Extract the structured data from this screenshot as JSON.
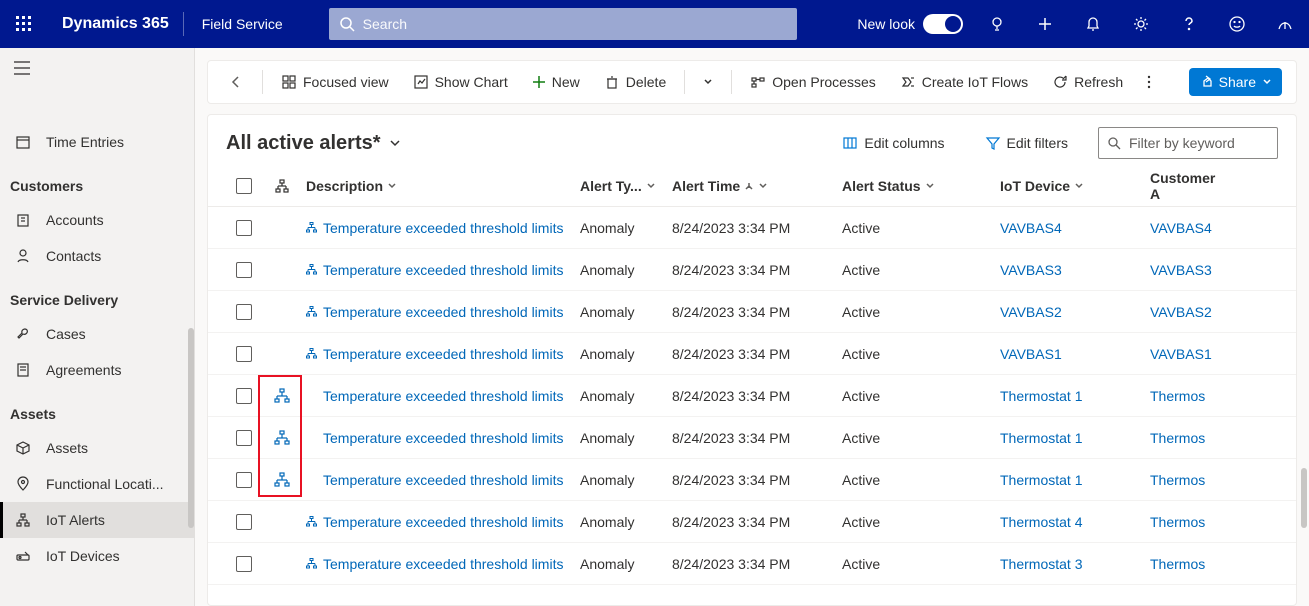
{
  "header": {
    "brand": "Dynamics 365",
    "module": "Field Service",
    "search_placeholder": "Search",
    "newlook": "New look"
  },
  "sidebar": {
    "item_truncated": "",
    "time_entries": "Time Entries",
    "sec_customers": "Customers",
    "accounts": "Accounts",
    "contacts": "Contacts",
    "sec_service": "Service Delivery",
    "cases": "Cases",
    "agreements": "Agreements",
    "sec_assets": "Assets",
    "assets": "Assets",
    "functional": "Functional Locati...",
    "iot_alerts": "IoT Alerts",
    "iot_devices": "IoT Devices"
  },
  "toolbar": {
    "focused": "Focused view",
    "show_chart": "Show Chart",
    "new": "New",
    "delete": "Delete",
    "open_proc": "Open Processes",
    "create_flows": "Create IoT Flows",
    "refresh": "Refresh",
    "share": "Share"
  },
  "grid": {
    "title": "All active alerts*",
    "edit_columns": "Edit columns",
    "edit_filters": "Edit filters",
    "filter_placeholder": "Filter by keyword",
    "cols": {
      "desc": "Description",
      "type": "Alert Ty...",
      "time": "Alert Time",
      "status": "Alert Status",
      "device": "IoT Device",
      "cust": "Customer A"
    },
    "rows": [
      {
        "hier": false,
        "desc": "Temperature exceeded threshold limits",
        "type": "Anomaly",
        "time": "8/24/2023 3:34 PM",
        "status": "Active",
        "device": "VAVBAS4",
        "cust": "VAVBAS4",
        "mini": true
      },
      {
        "hier": false,
        "desc": "Temperature exceeded threshold limits",
        "type": "Anomaly",
        "time": "8/24/2023 3:34 PM",
        "status": "Active",
        "device": "VAVBAS3",
        "cust": "VAVBAS3",
        "mini": true
      },
      {
        "hier": false,
        "desc": "Temperature exceeded threshold limits",
        "type": "Anomaly",
        "time": "8/24/2023 3:34 PM",
        "status": "Active",
        "device": "VAVBAS2",
        "cust": "VAVBAS2",
        "mini": true
      },
      {
        "hier": false,
        "desc": "Temperature exceeded threshold limits",
        "type": "Anomaly",
        "time": "8/24/2023 3:34 PM",
        "status": "Active",
        "device": "VAVBAS1",
        "cust": "VAVBAS1",
        "mini": true
      },
      {
        "hier": true,
        "desc": "Temperature exceeded threshold limits",
        "type": "Anomaly",
        "time": "8/24/2023 3:34 PM",
        "status": "Active",
        "device": "Thermostat 1",
        "cust": "Thermos",
        "mini": false
      },
      {
        "hier": true,
        "desc": "Temperature exceeded threshold limits",
        "type": "Anomaly",
        "time": "8/24/2023 3:34 PM",
        "status": "Active",
        "device": "Thermostat 1",
        "cust": "Thermos",
        "mini": false
      },
      {
        "hier": true,
        "desc": "Temperature exceeded threshold limits",
        "type": "Anomaly",
        "time": "8/24/2023 3:34 PM",
        "status": "Active",
        "device": "Thermostat 1",
        "cust": "Thermos",
        "mini": false
      },
      {
        "hier": false,
        "desc": "Temperature exceeded threshold limits",
        "type": "Anomaly",
        "time": "8/24/2023 3:34 PM",
        "status": "Active",
        "device": "Thermostat 4",
        "cust": "Thermos",
        "mini": true
      },
      {
        "hier": false,
        "desc": "Temperature exceeded threshold limits",
        "type": "Anomaly",
        "time": "8/24/2023 3:34 PM",
        "status": "Active",
        "device": "Thermostat 3",
        "cust": "Thermos",
        "mini": true
      }
    ]
  }
}
